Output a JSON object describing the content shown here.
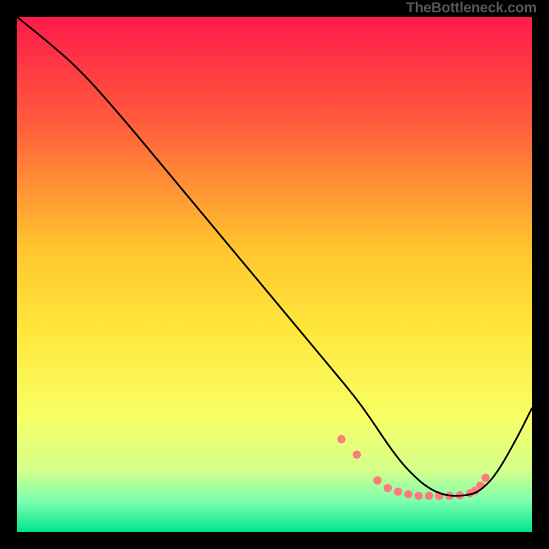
{
  "attribution": "TheBottleneck.com",
  "chart_data": {
    "type": "line",
    "title": "",
    "xlabel": "",
    "ylabel": "",
    "xlim": [
      0,
      100
    ],
    "ylim": [
      0,
      100
    ],
    "background_gradient": {
      "stops": [
        {
          "offset": 0,
          "color": "#ff1a4b"
        },
        {
          "offset": 20,
          "color": "#ff5a3c"
        },
        {
          "offset": 45,
          "color": "#ffc62e"
        },
        {
          "offset": 62,
          "color": "#ffe93d"
        },
        {
          "offset": 78,
          "color": "#f7ff66"
        },
        {
          "offset": 88,
          "color": "#d4ff8a"
        },
        {
          "offset": 94,
          "color": "#7dffb0"
        },
        {
          "offset": 100,
          "color": "#00e58b"
        }
      ]
    },
    "series": [
      {
        "name": "curve",
        "x": [
          0,
          5,
          12,
          20,
          30,
          40,
          50,
          60,
          65,
          68,
          72,
          75,
          78,
          80,
          82,
          84,
          86,
          88,
          90,
          93,
          97,
          100
        ],
        "y": [
          100,
          96,
          90,
          81,
          69,
          57,
          45,
          33,
          27,
          23,
          17,
          13,
          10,
          8.5,
          7.5,
          7,
          7,
          7.2,
          8,
          11,
          18,
          24
        ]
      }
    ],
    "markers": {
      "name": "dots",
      "x": [
        63,
        66,
        70,
        72,
        74,
        76,
        78,
        80,
        82,
        84,
        86,
        88,
        89,
        90,
        91
      ],
      "y": [
        18,
        15,
        10,
        8.5,
        7.8,
        7.3,
        7,
        7,
        7,
        7,
        7.1,
        7.5,
        8,
        9,
        10.5
      ],
      "color": "#ff7b7b",
      "radius": 6
    },
    "curve_stroke": "#000000",
    "curve_width": 2.6
  }
}
